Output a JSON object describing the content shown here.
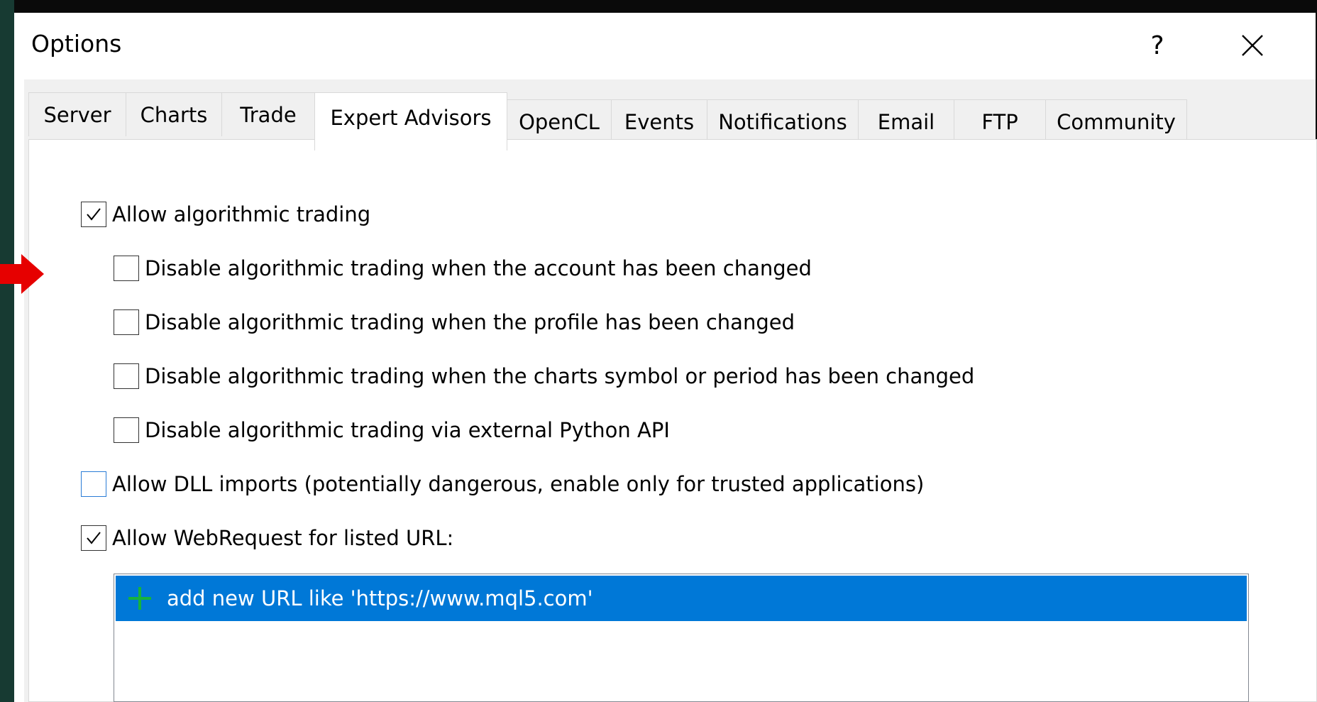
{
  "dialog": {
    "title": "Options",
    "help_label": "?",
    "close_icon": "close-icon"
  },
  "tabs": [
    {
      "label": "Server"
    },
    {
      "label": "Charts"
    },
    {
      "label": "Trade"
    },
    {
      "label": "Expert Advisors",
      "active": true
    },
    {
      "label": "OpenCL"
    },
    {
      "label": "Events"
    },
    {
      "label": "Notifications"
    },
    {
      "label": "Email"
    },
    {
      "label": "FTP"
    },
    {
      "label": "Community"
    }
  ],
  "options": {
    "allow_algo": {
      "label": "Allow algorithmic trading",
      "checked": true
    },
    "disable_account": {
      "label": "Disable algorithmic trading when the account has been changed",
      "checked": false
    },
    "disable_profile": {
      "label": "Disable algorithmic trading when the profile has been changed",
      "checked": false
    },
    "disable_symbol": {
      "label": "Disable algorithmic trading when the charts symbol or period has been changed",
      "checked": false
    },
    "disable_python": {
      "label": "Disable algorithmic trading via external Python API",
      "checked": false
    },
    "allow_dll": {
      "label": "Allow DLL imports (potentially dangerous, enable only for trusted applications)",
      "checked": false
    },
    "allow_webrequest": {
      "label": "Allow WebRequest for listed URL:",
      "checked": true
    }
  },
  "url_list": {
    "add_row_text": "add new URL like 'https://www.mql5.com'",
    "add_icon": "plus-icon"
  },
  "colors": {
    "selection": "#0078d7",
    "plus": "#16b33c",
    "annotation_arrow": "#e60000",
    "background_edge": "#173a32"
  }
}
